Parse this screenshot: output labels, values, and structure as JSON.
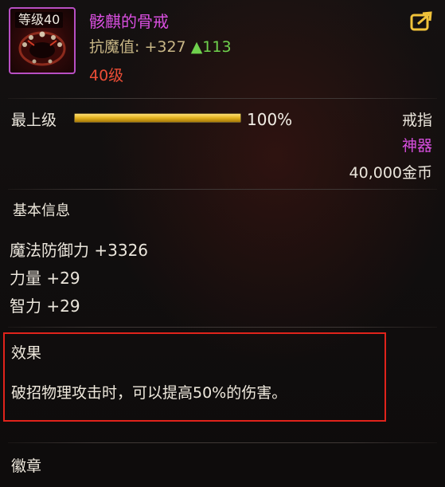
{
  "item": {
    "icon_name": "ring-icon",
    "level_badge": "等级40",
    "name": "骸麒的骨戒",
    "stat_text": "抗魔值: +327",
    "stat_delta": "▲113",
    "required_level": "40级"
  },
  "upgrade": {
    "label": "最上级",
    "progress_percent": 100,
    "progress_text": "100%"
  },
  "meta": {
    "type": "戒指",
    "rarity": "神器",
    "price": "40,000金币"
  },
  "basic_info": {
    "title": "基本信息",
    "attributes": [
      "魔法防御力 +3326",
      "力量 +29",
      "智力 +29"
    ]
  },
  "effect": {
    "title": "效果",
    "text": "破招物理攻击时，可以提高50%的伤害。"
  },
  "emblem": {
    "title": "徽章"
  },
  "colors": {
    "epic_purple": "#d94fe0",
    "level_red": "#ea4d36",
    "stat_green": "#6fd14d",
    "highlight_red": "#e0231b",
    "progress_gold": "#e3b11f"
  }
}
